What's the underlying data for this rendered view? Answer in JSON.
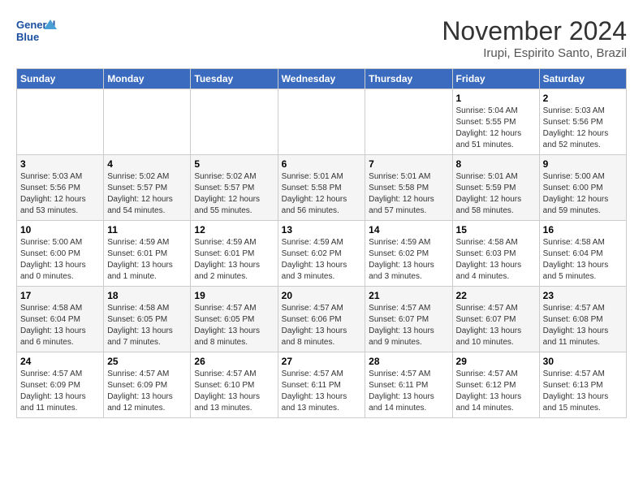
{
  "logo": {
    "line1": "General",
    "line2": "Blue"
  },
  "title": "November 2024",
  "location": "Irupi, Espirito Santo, Brazil",
  "weekdays": [
    "Sunday",
    "Monday",
    "Tuesday",
    "Wednesday",
    "Thursday",
    "Friday",
    "Saturday"
  ],
  "weeks": [
    [
      {
        "day": "",
        "info": ""
      },
      {
        "day": "",
        "info": ""
      },
      {
        "day": "",
        "info": ""
      },
      {
        "day": "",
        "info": ""
      },
      {
        "day": "",
        "info": ""
      },
      {
        "day": "1",
        "info": "Sunrise: 5:04 AM\nSunset: 5:55 PM\nDaylight: 12 hours and 51 minutes."
      },
      {
        "day": "2",
        "info": "Sunrise: 5:03 AM\nSunset: 5:56 PM\nDaylight: 12 hours and 52 minutes."
      }
    ],
    [
      {
        "day": "3",
        "info": "Sunrise: 5:03 AM\nSunset: 5:56 PM\nDaylight: 12 hours and 53 minutes."
      },
      {
        "day": "4",
        "info": "Sunrise: 5:02 AM\nSunset: 5:57 PM\nDaylight: 12 hours and 54 minutes."
      },
      {
        "day": "5",
        "info": "Sunrise: 5:02 AM\nSunset: 5:57 PM\nDaylight: 12 hours and 55 minutes."
      },
      {
        "day": "6",
        "info": "Sunrise: 5:01 AM\nSunset: 5:58 PM\nDaylight: 12 hours and 56 minutes."
      },
      {
        "day": "7",
        "info": "Sunrise: 5:01 AM\nSunset: 5:58 PM\nDaylight: 12 hours and 57 minutes."
      },
      {
        "day": "8",
        "info": "Sunrise: 5:01 AM\nSunset: 5:59 PM\nDaylight: 12 hours and 58 minutes."
      },
      {
        "day": "9",
        "info": "Sunrise: 5:00 AM\nSunset: 6:00 PM\nDaylight: 12 hours and 59 minutes."
      }
    ],
    [
      {
        "day": "10",
        "info": "Sunrise: 5:00 AM\nSunset: 6:00 PM\nDaylight: 13 hours and 0 minutes."
      },
      {
        "day": "11",
        "info": "Sunrise: 4:59 AM\nSunset: 6:01 PM\nDaylight: 13 hours and 1 minute."
      },
      {
        "day": "12",
        "info": "Sunrise: 4:59 AM\nSunset: 6:01 PM\nDaylight: 13 hours and 2 minutes."
      },
      {
        "day": "13",
        "info": "Sunrise: 4:59 AM\nSunset: 6:02 PM\nDaylight: 13 hours and 3 minutes."
      },
      {
        "day": "14",
        "info": "Sunrise: 4:59 AM\nSunset: 6:02 PM\nDaylight: 13 hours and 3 minutes."
      },
      {
        "day": "15",
        "info": "Sunrise: 4:58 AM\nSunset: 6:03 PM\nDaylight: 13 hours and 4 minutes."
      },
      {
        "day": "16",
        "info": "Sunrise: 4:58 AM\nSunset: 6:04 PM\nDaylight: 13 hours and 5 minutes."
      }
    ],
    [
      {
        "day": "17",
        "info": "Sunrise: 4:58 AM\nSunset: 6:04 PM\nDaylight: 13 hours and 6 minutes."
      },
      {
        "day": "18",
        "info": "Sunrise: 4:58 AM\nSunset: 6:05 PM\nDaylight: 13 hours and 7 minutes."
      },
      {
        "day": "19",
        "info": "Sunrise: 4:57 AM\nSunset: 6:05 PM\nDaylight: 13 hours and 8 minutes."
      },
      {
        "day": "20",
        "info": "Sunrise: 4:57 AM\nSunset: 6:06 PM\nDaylight: 13 hours and 8 minutes."
      },
      {
        "day": "21",
        "info": "Sunrise: 4:57 AM\nSunset: 6:07 PM\nDaylight: 13 hours and 9 minutes."
      },
      {
        "day": "22",
        "info": "Sunrise: 4:57 AM\nSunset: 6:07 PM\nDaylight: 13 hours and 10 minutes."
      },
      {
        "day": "23",
        "info": "Sunrise: 4:57 AM\nSunset: 6:08 PM\nDaylight: 13 hours and 11 minutes."
      }
    ],
    [
      {
        "day": "24",
        "info": "Sunrise: 4:57 AM\nSunset: 6:09 PM\nDaylight: 13 hours and 11 minutes."
      },
      {
        "day": "25",
        "info": "Sunrise: 4:57 AM\nSunset: 6:09 PM\nDaylight: 13 hours and 12 minutes."
      },
      {
        "day": "26",
        "info": "Sunrise: 4:57 AM\nSunset: 6:10 PM\nDaylight: 13 hours and 13 minutes."
      },
      {
        "day": "27",
        "info": "Sunrise: 4:57 AM\nSunset: 6:11 PM\nDaylight: 13 hours and 13 minutes."
      },
      {
        "day": "28",
        "info": "Sunrise: 4:57 AM\nSunset: 6:11 PM\nDaylight: 13 hours and 14 minutes."
      },
      {
        "day": "29",
        "info": "Sunrise: 4:57 AM\nSunset: 6:12 PM\nDaylight: 13 hours and 14 minutes."
      },
      {
        "day": "30",
        "info": "Sunrise: 4:57 AM\nSunset: 6:13 PM\nDaylight: 13 hours and 15 minutes."
      }
    ]
  ]
}
